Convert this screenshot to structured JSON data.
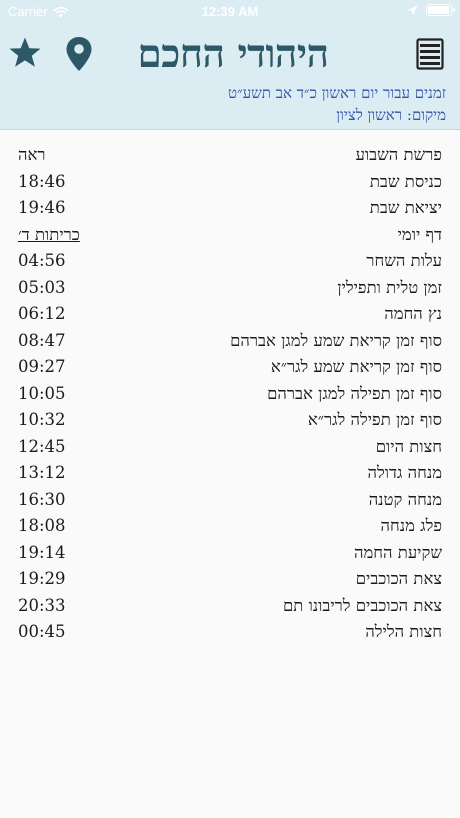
{
  "status_bar": {
    "carrier": "Carrier",
    "time": "12:39 AM",
    "text_color": "#ffffff"
  },
  "header": {
    "title": "היהודי החכם",
    "subtitle_date": "זמנים עבור יום ראשון כ״ד אב תשע״ט",
    "subtitle_location": "מיקום: ראשון לציון",
    "background": "#dcecf3",
    "title_color": "#2c5868",
    "subtitle_color": "#3354a8",
    "icons": [
      "star-icon",
      "location-pin-icon",
      "menu-icon"
    ]
  },
  "rows": [
    {
      "label": "פרשת השבוע",
      "value": "ראה"
    },
    {
      "label": "כניסת שבת",
      "value": "18:46"
    },
    {
      "label": "יציאת שבת",
      "value": "19:46"
    },
    {
      "label": "דף יומי",
      "value": "כריתות ד׳"
    },
    {
      "label": "עלות השחר",
      "value": "04:56"
    },
    {
      "label": "זמן טלית ותפילין",
      "value": "05:03"
    },
    {
      "label": "נץ החמה",
      "value": "06:12"
    },
    {
      "label": "סוף זמן קריאת שמע למגן אברהם",
      "value": "08:47"
    },
    {
      "label": "סוף זמן קריאת שמע לגר״א",
      "value": "09:27"
    },
    {
      "label": "סוף זמן תפילה למגן אברהם",
      "value": "10:05"
    },
    {
      "label": "סוף זמן תפילה לגר״א",
      "value": "10:32"
    },
    {
      "label": "חצות היום",
      "value": "12:45"
    },
    {
      "label": "מנחה גדולה",
      "value": "13:12"
    },
    {
      "label": "מנחה קטנה",
      "value": "16:30"
    },
    {
      "label": "פלג מנחה",
      "value": "18:08"
    },
    {
      "label": "שקיעת החמה",
      "value": "19:14"
    },
    {
      "label": "צאת הכוכבים",
      "value": "19:29"
    },
    {
      "label": "צאת הכוכבים לריבונו תם",
      "value": "20:33"
    },
    {
      "label": "חצות הלילה",
      "value": "00:45"
    }
  ]
}
